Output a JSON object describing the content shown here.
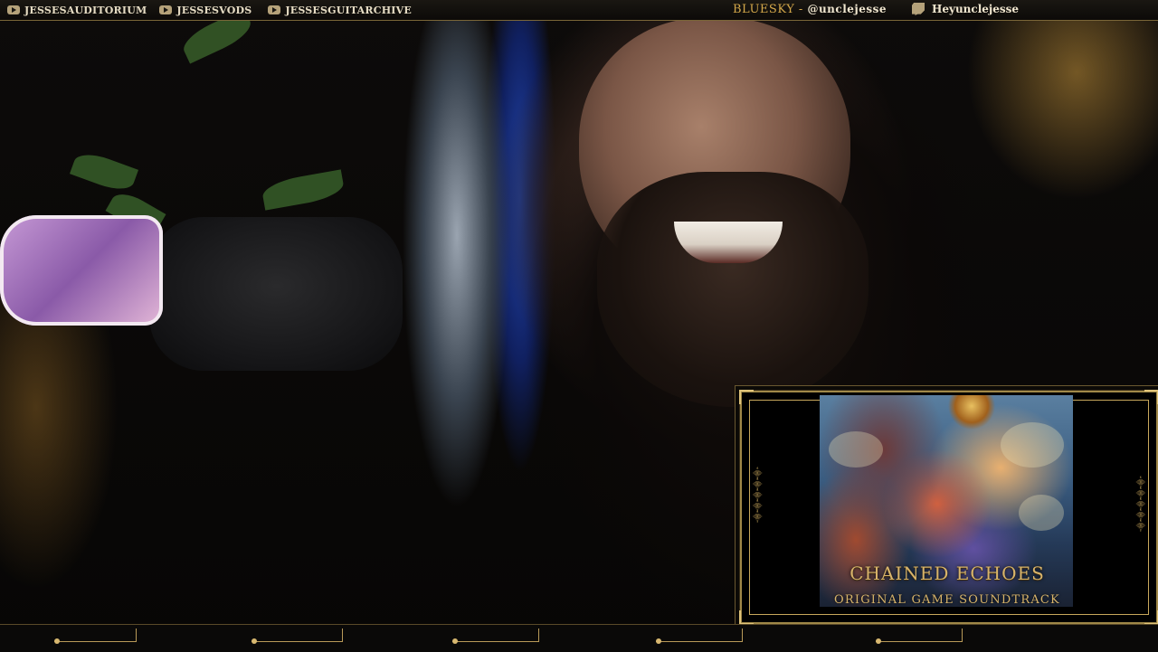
{
  "topbar": {
    "channels": [
      {
        "icon": "youtube-icon",
        "label": "JESSESAUDITORIUM"
      },
      {
        "icon": "youtube-icon",
        "label": "JESSESVODS"
      },
      {
        "icon": "youtube-icon",
        "label": "JESSESGUITARCHIVE"
      }
    ],
    "bluesky_label": "BLUESKY -",
    "bluesky_handle": "@unclejesse",
    "twitch_icon": "twitch-icon",
    "twitch_handle": "Heyunclejesse"
  },
  "overlay": {
    "album_title": "CHAINED ECHOES",
    "album_subtitle": "ORIGINAL GAME SOUNDTRACK",
    "rune_glyph": "⸎"
  },
  "colors": {
    "accent_gold": "#d8b46a",
    "frame_gold": "#a08848",
    "text_cream": "#f0e6cf"
  }
}
